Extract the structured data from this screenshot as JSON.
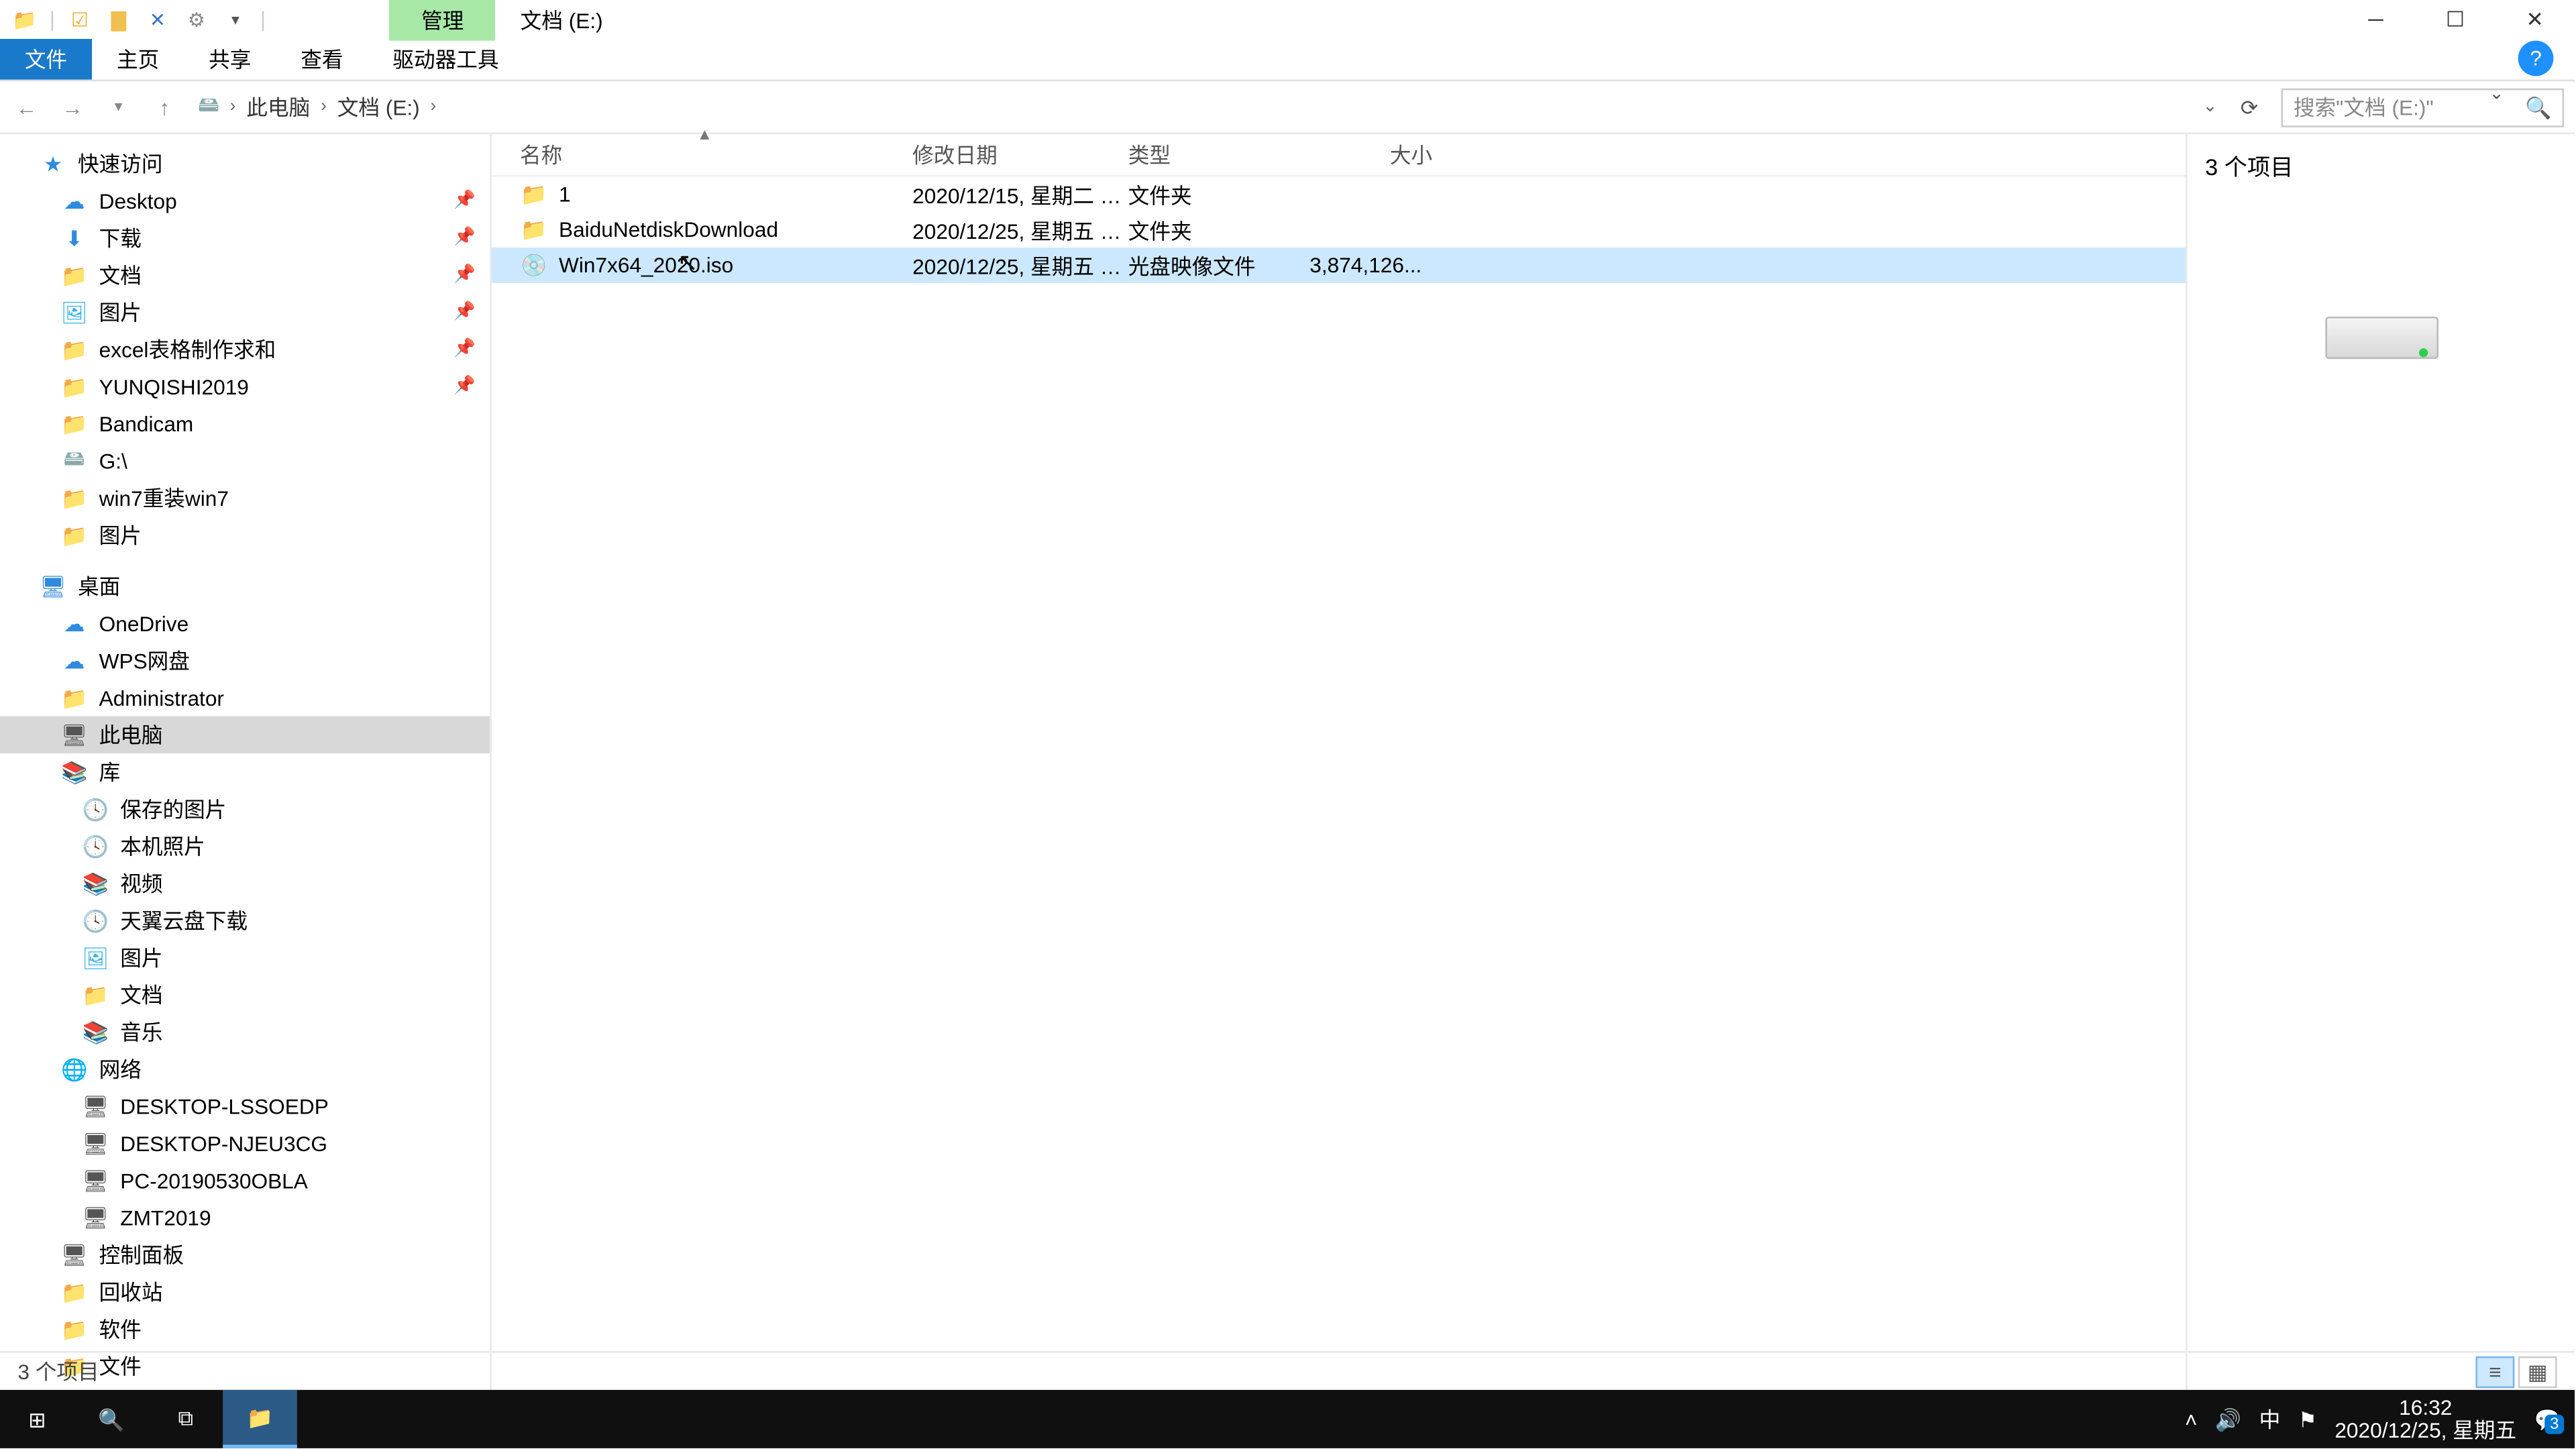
{
  "title": {
    "context_tab": "管理",
    "location": "文档 (E:)"
  },
  "ribbon": {
    "file": "文件",
    "home": "主页",
    "share": "共享",
    "view": "查看",
    "drive": "驱动器工具"
  },
  "breadcrumb": {
    "pc": "此电脑",
    "drive": "文档 (E:)"
  },
  "search": {
    "placeholder": "搜索\"文档 (E:)\""
  },
  "columns": {
    "name": "名称",
    "date": "修改日期",
    "type": "类型",
    "size": "大小"
  },
  "rows": [
    {
      "icon": "folder",
      "name": "1",
      "date": "2020/12/15, 星期二 1...",
      "type": "文件夹",
      "size": ""
    },
    {
      "icon": "folder",
      "name": "BaiduNetdiskDownload",
      "date": "2020/12/25, 星期五 1...",
      "type": "文件夹",
      "size": ""
    },
    {
      "icon": "iso",
      "name": "Win7x64_2020.iso",
      "date": "2020/12/25, 星期五 1...",
      "type": "光盘映像文件",
      "size": "3,874,126..."
    }
  ],
  "preview": {
    "count": "3 个项目"
  },
  "status": {
    "count": "3 个项目"
  },
  "nav": {
    "quick": "快速访问",
    "quick_items": [
      {
        "label": "Desktop",
        "ic": "dsk"
      },
      {
        "label": "下载",
        "ic": "dl"
      },
      {
        "label": "文档",
        "ic": "fld"
      },
      {
        "label": "图片",
        "ic": "pic"
      },
      {
        "label": "excel表格制作求和",
        "ic": "fld"
      },
      {
        "label": "YUNQISHI2019",
        "ic": "fld"
      },
      {
        "label": "Bandicam",
        "ic": "fld"
      },
      {
        "label": "G:\\",
        "ic": "drive"
      },
      {
        "label": "win7重装win7",
        "ic": "fld"
      },
      {
        "label": "图片",
        "ic": "fld"
      }
    ],
    "desktop": "桌面",
    "desktop_items": [
      {
        "label": "OneDrive",
        "ic": "dsk"
      },
      {
        "label": "WPS网盘",
        "ic": "dsk"
      },
      {
        "label": "Administrator",
        "ic": "fld"
      },
      {
        "label": "此电脑",
        "ic": "pc",
        "sel": true
      },
      {
        "label": "库",
        "ic": "lib"
      },
      {
        "label": "保存的图片",
        "ic": "clock"
      },
      {
        "label": "本机照片",
        "ic": "clock"
      },
      {
        "label": "视频",
        "ic": "lib"
      },
      {
        "label": "天翼云盘下载",
        "ic": "clock"
      },
      {
        "label": "图片",
        "ic": "pic"
      },
      {
        "label": "文档",
        "ic": "fld"
      },
      {
        "label": "音乐",
        "ic": "lib"
      },
      {
        "label": "网络",
        "ic": "net"
      },
      {
        "label": "DESKTOP-LSSOEDP",
        "ic": "pc"
      },
      {
        "label": "DESKTOP-NJEU3CG",
        "ic": "pc"
      },
      {
        "label": "PC-20190530OBLA",
        "ic": "pc"
      },
      {
        "label": "ZMT2019",
        "ic": "pc"
      },
      {
        "label": "控制面板",
        "ic": "pc"
      },
      {
        "label": "回收站",
        "ic": "fld"
      },
      {
        "label": "软件",
        "ic": "fld"
      },
      {
        "label": "文件",
        "ic": "fld"
      }
    ]
  },
  "tray": {
    "ime": "中",
    "time": "16:32",
    "date": "2020/12/25, 星期五",
    "badge": "3"
  }
}
